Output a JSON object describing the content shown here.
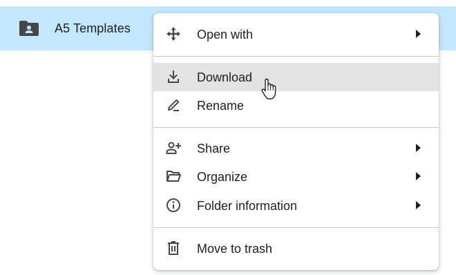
{
  "folder": {
    "name": "A5 Templates",
    "icon": "shared-folder-icon"
  },
  "menu": {
    "items": [
      {
        "label": "Open with",
        "icon": "move-arrows-icon",
        "submenu": true
      },
      {
        "label": "Download",
        "icon": "download-icon",
        "submenu": false,
        "hovered": true
      },
      {
        "label": "Rename",
        "icon": "pencil-icon",
        "submenu": false
      },
      {
        "label": "Share",
        "icon": "person-add-icon",
        "submenu": true
      },
      {
        "label": "Organize",
        "icon": "folder-open-icon",
        "submenu": true
      },
      {
        "label": "Folder information",
        "icon": "info-icon",
        "submenu": true
      },
      {
        "label": "Move to trash",
        "icon": "trash-icon",
        "submenu": false
      }
    ]
  },
  "colors": {
    "selected_row": "#c2e7ff",
    "hover_item": "#e3e3e3",
    "text": "#1f1f1f",
    "icon": "#444746"
  }
}
